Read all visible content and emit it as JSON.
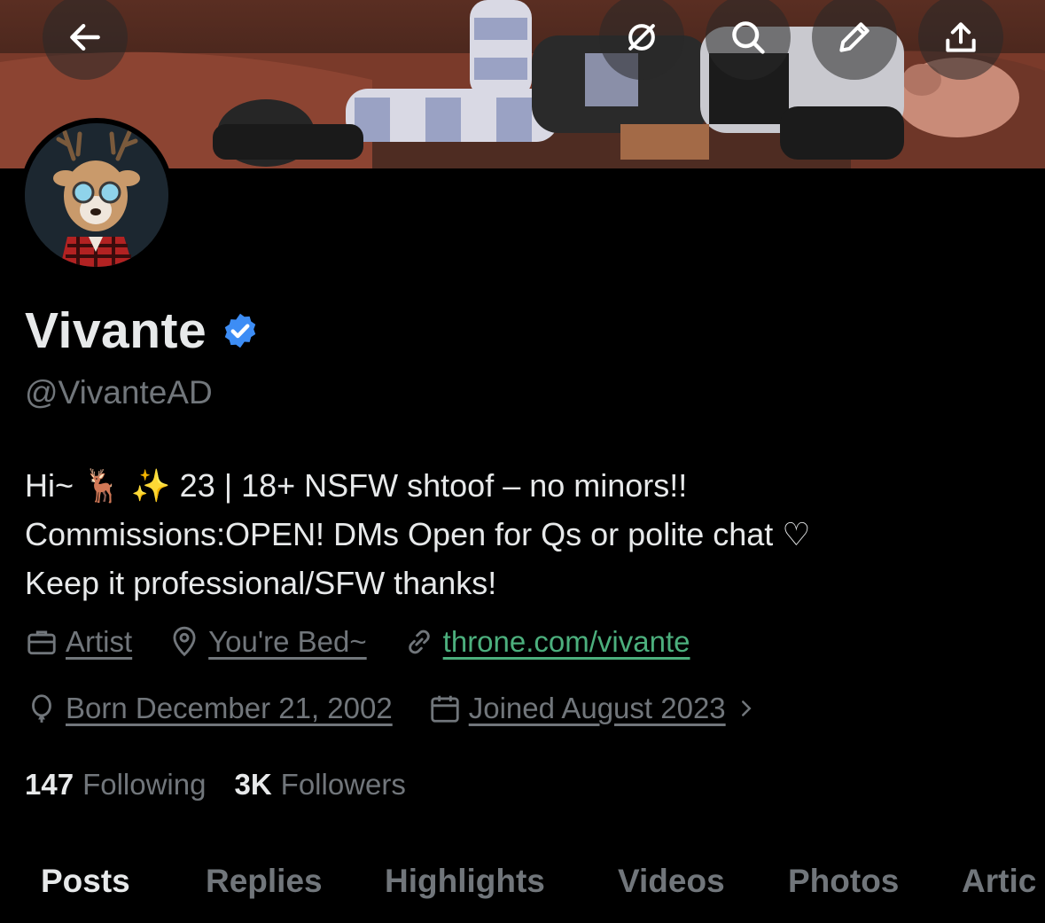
{
  "header": {
    "back_icon": "arrow-left-icon",
    "actions": [
      {
        "name": "hide-icon"
      },
      {
        "name": "search-icon"
      },
      {
        "name": "edit-icon"
      },
      {
        "name": "share-icon"
      }
    ]
  },
  "profile": {
    "display_name": "Vivante",
    "verified": true,
    "verified_color": "#3d8df5",
    "handle": "@VivanteAD",
    "bio": [
      "Hi~ 🦌 ✨ 23 | 18+ NSFW shtoof – no minors!!",
      "Commissions:OPEN! DMs Open for Qs or polite chat ♡",
      "Keep it professional/SFW thanks!"
    ],
    "profession": "Artist",
    "location": "You're Bed~",
    "website": "throne.com/vivante",
    "birthday": "Born December 21, 2002",
    "joined": "Joined August 2023"
  },
  "stats": {
    "following_count": "147",
    "following_label": "Following",
    "followers_count": "3K",
    "followers_label": "Followers"
  },
  "tabs": [
    "Posts",
    "Replies",
    "Highlights",
    "Videos",
    "Photos",
    "Artic"
  ],
  "colors": {
    "link": "#4caf7d",
    "muted": "#71767b",
    "text": "#e7e9ea",
    "background": "#000000"
  }
}
